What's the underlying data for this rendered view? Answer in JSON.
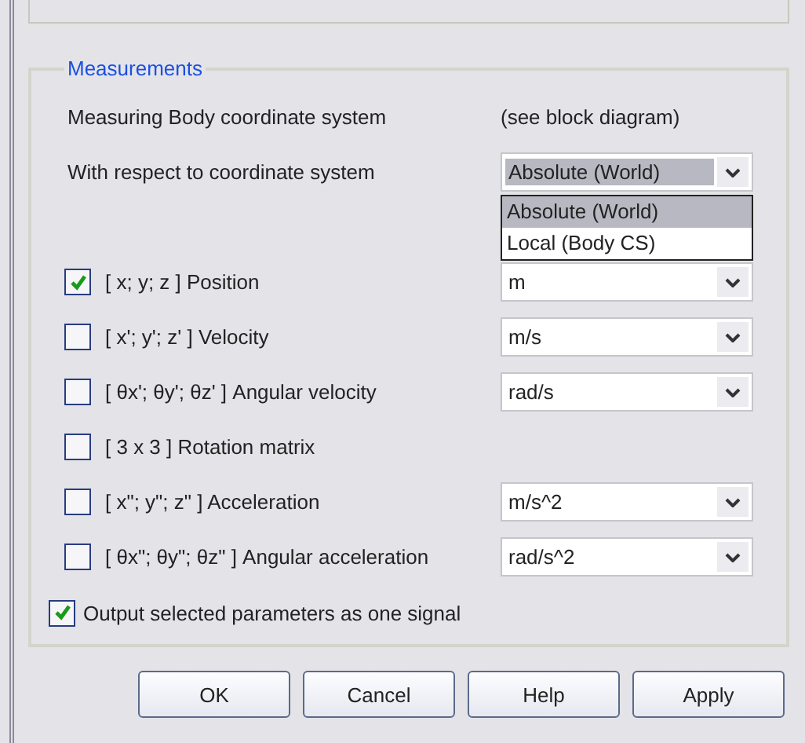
{
  "group": {
    "title": "Measurements"
  },
  "info": {
    "label": "Measuring Body coordinate system",
    "value": "(see block diagram)"
  },
  "coordinate_system": {
    "label": "With respect to coordinate system",
    "value": "Absolute (World)",
    "focused": true,
    "expanded": true,
    "options": [
      {
        "label": "Absolute (World)",
        "selected": true
      },
      {
        "label": "Local (Body CS)",
        "selected": false
      }
    ]
  },
  "measurements": [
    {
      "label": "[ x; y; z ] Position",
      "checked": true,
      "unit": "m"
    },
    {
      "label": "[ x'; y'; z' ] Velocity",
      "checked": false,
      "unit": "m/s"
    },
    {
      "label": "[ θx'; θy'; θz' ] Angular velocity",
      "checked": false,
      "unit": "rad/s"
    },
    {
      "label": "[ 3 x 3 ] Rotation matrix",
      "checked": false
    },
    {
      "label": "[ x\"; y\"; z\" ] Acceleration",
      "checked": false,
      "unit": "m/s^2"
    },
    {
      "label": "[ θx\"; θy\"; θz\" ] Angular acceleration",
      "checked": false,
      "unit": "rad/s^2"
    }
  ],
  "output_signal": {
    "label": "Output selected parameters as one signal",
    "checked": true
  },
  "buttons": [
    "OK",
    "Cancel",
    "Help",
    "Apply"
  ]
}
